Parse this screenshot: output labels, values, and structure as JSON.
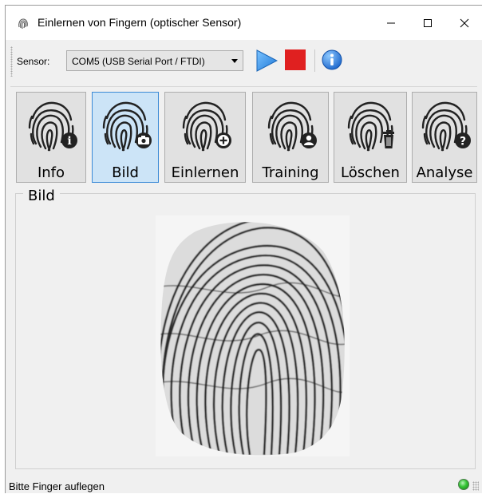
{
  "window": {
    "title": "Einlernen von Fingern (optischer Sensor)",
    "controls": {
      "minimize": "minimize-icon",
      "maximize": "maximize-icon",
      "close": "close-icon"
    }
  },
  "toolbar": {
    "sensor_label": "Sensor:",
    "sensor_value": "COM5 (USB Serial Port / FTDI)",
    "start_icon": "play-icon",
    "stop_icon": "stop-icon",
    "about_icon": "info-icon",
    "accent_colors": {
      "play": "#2b8fe8",
      "stop": "#e02020",
      "info": "#1e6fd0"
    }
  },
  "tool_buttons": [
    {
      "label": "Info",
      "icon": "fingerprint-info-icon",
      "active": false
    },
    {
      "label": "Bild",
      "icon": "fingerprint-camera-icon",
      "active": true
    },
    {
      "label": "Einlernen",
      "icon": "fingerprint-add-icon",
      "active": false
    },
    {
      "label": "Training",
      "icon": "fingerprint-user-icon",
      "active": false
    },
    {
      "label": "Löschen",
      "icon": "fingerprint-delete-icon",
      "active": false
    },
    {
      "label": "Analyse",
      "icon": "fingerprint-help-icon",
      "active": false
    }
  ],
  "panel": {
    "title": "Bild"
  },
  "status": {
    "text": "Bitte Finger auflegen",
    "led_color": "#34c534"
  }
}
